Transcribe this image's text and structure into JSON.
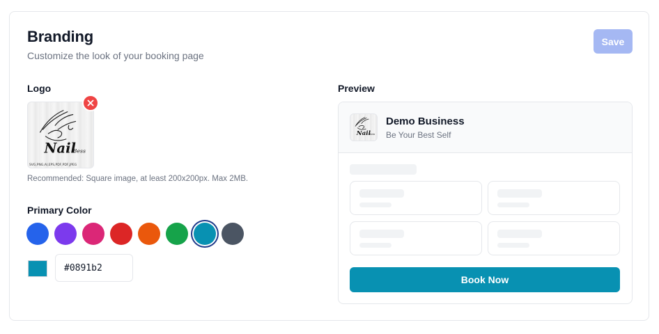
{
  "header": {
    "title": "Branding",
    "subtitle": "Customize the look of your booking page",
    "save_label": "Save"
  },
  "logo": {
    "label": "Logo",
    "hint": "Recommended: Square image, at least 200x200px. Max 2MB.",
    "remove_icon": "close-icon",
    "brand_text": "Nail",
    "brand_text_small": "Bess",
    "brand_caption": "SVG,PNG,AI,EPS,PDF,PDF,JPEG"
  },
  "color": {
    "label": "Primary Color",
    "swatches": [
      "#2563eb",
      "#7c3aed",
      "#db2777",
      "#dc2626",
      "#ea580c",
      "#16a34a",
      "#0891b2",
      "#4b5563"
    ],
    "selected_index": 6,
    "value": "#0891b2"
  },
  "preview": {
    "label": "Preview",
    "business_name": "Demo Business",
    "tagline": "Be Your Best Self",
    "book_label": "Book Now",
    "accent": "#0891b2"
  }
}
